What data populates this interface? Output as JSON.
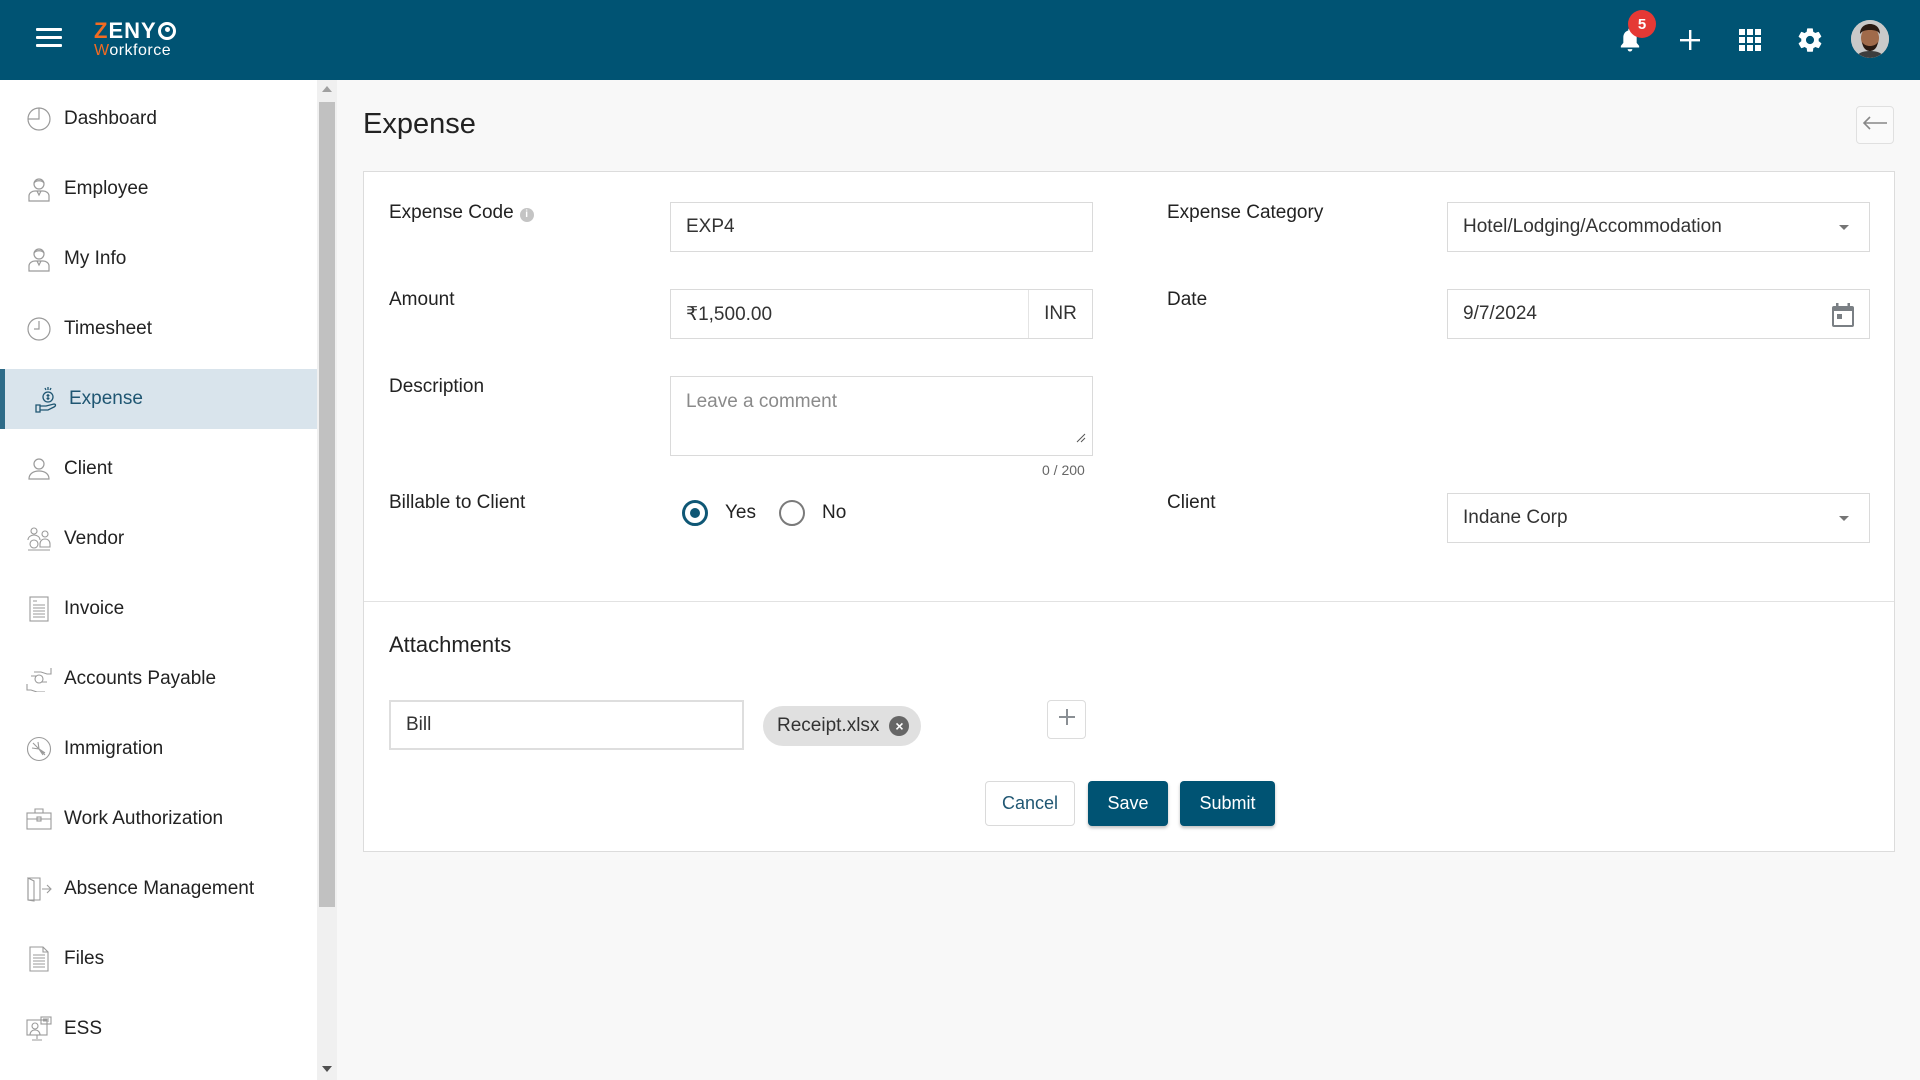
{
  "app": {
    "logo_line1_first": "Z",
    "logo_line1_rest": "ENY",
    "logo_line2_first": "W",
    "logo_line2_rest": "orkforce",
    "notification_count": "5",
    "brand_color": "#005373",
    "accent_color": "#f26b22"
  },
  "header_icons": [
    "menu-icon",
    "bell-icon",
    "plus-icon",
    "apps-grid-icon",
    "gear-icon",
    "user-avatar"
  ],
  "sidebar": {
    "items": [
      {
        "label": "Dashboard",
        "icon": "dashboard-icon"
      },
      {
        "label": "Employee",
        "icon": "employee-icon"
      },
      {
        "label": "My Info",
        "icon": "my-info-icon"
      },
      {
        "label": "Timesheet",
        "icon": "clock-icon"
      },
      {
        "label": "Expense",
        "icon": "expense-icon",
        "active": true
      },
      {
        "label": "Client",
        "icon": "client-icon"
      },
      {
        "label": "Vendor",
        "icon": "vendor-icon"
      },
      {
        "label": "Invoice",
        "icon": "invoice-icon"
      },
      {
        "label": "Accounts Payable",
        "icon": "accounts-payable-icon"
      },
      {
        "label": "Immigration",
        "icon": "immigration-icon"
      },
      {
        "label": "Work Authorization",
        "icon": "briefcase-icon"
      },
      {
        "label": "Absence Management",
        "icon": "door-exit-icon"
      },
      {
        "label": "Files",
        "icon": "file-icon"
      },
      {
        "label": "ESS",
        "icon": "ess-icon"
      }
    ]
  },
  "page": {
    "title": "Expense"
  },
  "form": {
    "expense_code": {
      "label": "Expense Code",
      "value": "EXP4"
    },
    "expense_category": {
      "label": "Expense Category",
      "value": "Hotel/Lodging/Accommodation"
    },
    "amount": {
      "label": "Amount",
      "value": "₹1,500.00",
      "currency": "INR"
    },
    "date": {
      "label": "Date",
      "value": "9/7/2024"
    },
    "description": {
      "label": "Description",
      "placeholder": "Leave a comment",
      "counter": "0 / 200"
    },
    "billable": {
      "label": "Billable to Client",
      "options": [
        "Yes",
        "No"
      ],
      "selected": "Yes"
    },
    "client": {
      "label": "Client",
      "value": "Indane Corp"
    }
  },
  "attachments": {
    "title": "Attachments",
    "name_value": "Bill",
    "file_chip": "Receipt.xlsx"
  },
  "actions": {
    "cancel": "Cancel",
    "save": "Save",
    "submit": "Submit"
  }
}
